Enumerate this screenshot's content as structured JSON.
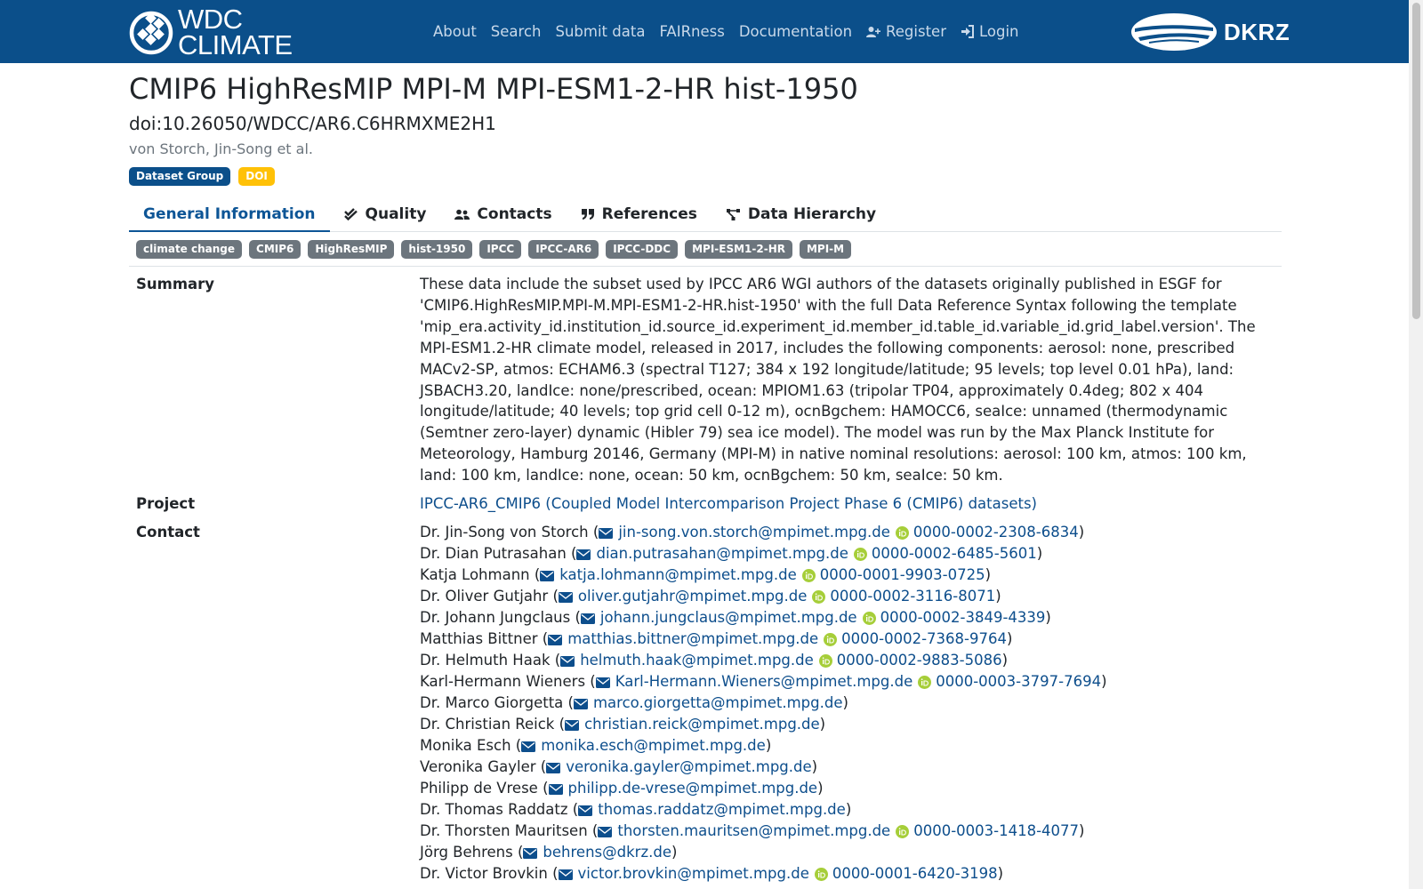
{
  "header": {
    "logo_line1": "WDC",
    "logo_line2": "CLIMATE",
    "nav": [
      {
        "label": "About"
      },
      {
        "label": "Search"
      },
      {
        "label": "Submit data"
      },
      {
        "label": "FAIRness"
      },
      {
        "label": "Documentation"
      },
      {
        "label": "Register",
        "icon": "user-plus-icon"
      },
      {
        "label": "Login",
        "icon": "login-icon"
      }
    ],
    "partner_logo_text": "DKRZ"
  },
  "dataset": {
    "title": "CMIP6 HighResMIP MPI-M MPI-ESM1-2-HR hist-1950",
    "doi": "doi:10.26050/WDCC/AR6.C6HRMXME2H1",
    "authors": "von Storch, Jin-Song et al.",
    "badges": [
      "Dataset Group",
      "DOI"
    ]
  },
  "tabs": [
    {
      "label": "General Information",
      "icon": "info-icon",
      "active": true
    },
    {
      "label": "Quality",
      "icon": "check-double-icon"
    },
    {
      "label": "Contacts",
      "icon": "users-icon"
    },
    {
      "label": "References",
      "icon": "quote-icon"
    },
    {
      "label": "Data Hierarchy",
      "icon": "hierarchy-icon"
    }
  ],
  "tags": [
    "climate change",
    "CMIP6",
    "HighResMIP",
    "hist-1950",
    "IPCC",
    "IPCC-AR6",
    "IPCC-DDC",
    "MPI-ESM1-2-HR",
    "MPI-M"
  ],
  "summary": {
    "label": "Summary",
    "text": "These data include the subset used by IPCC AR6 WGI authors of the datasets originally published in ESGF for 'CMIP6.HighResMIP.MPI-M.MPI-ESM1-2-HR.hist-1950' with the full Data Reference Syntax following the template 'mip_era.activity_id.institution_id.source_id.experiment_id.member_id.table_id.variable_id.grid_label.version'. The MPI-ESM1.2-HR climate model, released in 2017, includes the following components: aerosol: none, prescribed MACv2-SP, atmos: ECHAM6.3 (spectral T127; 384 x 192 longitude/latitude; 95 levels; top level 0.01 hPa), land: JSBACH3.20, landIce: none/prescribed, ocean: MPIOM1.63 (tripolar TP04, approximately 0.4deg; 802 x 404 longitude/latitude; 40 levels; top grid cell 0-12 m), ocnBgchem: HAMOCC6, seaIce: unnamed (thermodynamic (Semtner zero-layer) dynamic (Hibler 79) sea ice model). The model was run by the Max Planck Institute for Meteorology, Hamburg 20146, Germany (MPI-M) in native nominal resolutions: aerosol: 100 km, atmos: 100 km, land: 100 km, landIce: none, ocean: 50 km, ocnBgchem: 50 km, seaIce: 50 km."
  },
  "project": {
    "label": "Project",
    "link_text": "IPCC-AR6_CMIP6 (Coupled Model Intercomparison Project Phase 6 (CMIP6) datasets)"
  },
  "contact": {
    "label": "Contact",
    "people": [
      {
        "name": "Dr. Jin-Song von Storch",
        "email": "jin-song.von.storch@mpimet.mpg.de",
        "orcid": "0000-0002-2308-6834"
      },
      {
        "name": "Dr. Dian Putrasahan",
        "email": "dian.putrasahan@mpimet.mpg.de",
        "orcid": "0000-0002-6485-5601"
      },
      {
        "name": "Katja Lohmann",
        "email": "katja.lohmann@mpimet.mpg.de",
        "orcid": "0000-0001-9903-0725"
      },
      {
        "name": "Dr. Oliver Gutjahr",
        "email": "oliver.gutjahr@mpimet.mpg.de",
        "orcid": "0000-0002-3116-8071"
      },
      {
        "name": "Dr. Johann Jungclaus",
        "email": "johann.jungclaus@mpimet.mpg.de",
        "orcid": "0000-0002-3849-4339"
      },
      {
        "name": "Matthias Bittner",
        "email": "matthias.bittner@mpimet.mpg.de",
        "orcid": "0000-0002-7368-9764"
      },
      {
        "name": "Dr. Helmuth Haak",
        "email": "helmuth.haak@mpimet.mpg.de",
        "orcid": "0000-0002-9883-5086"
      },
      {
        "name": "Karl-Hermann Wieners",
        "email": "Karl-Hermann.Wieners@mpimet.mpg.de",
        "orcid": "0000-0003-3797-7694"
      },
      {
        "name": "Dr. Marco Giorgetta",
        "email": "marco.giorgetta@mpimet.mpg.de",
        "orcid": ""
      },
      {
        "name": "Dr. Christian Reick",
        "email": "christian.reick@mpimet.mpg.de",
        "orcid": ""
      },
      {
        "name": "Monika Esch",
        "email": "monika.esch@mpimet.mpg.de",
        "orcid": ""
      },
      {
        "name": "Veronika Gayler",
        "email": "veronika.gayler@mpimet.mpg.de",
        "orcid": ""
      },
      {
        "name": "Philipp de Vrese",
        "email": "philipp.de-vrese@mpimet.mpg.de",
        "orcid": ""
      },
      {
        "name": "Dr. Thomas Raddatz",
        "email": "thomas.raddatz@mpimet.mpg.de",
        "orcid": ""
      },
      {
        "name": "Dr. Thorsten Mauritsen",
        "email": "thorsten.mauritsen@mpimet.mpg.de",
        "orcid": "0000-0003-1418-4077"
      },
      {
        "name": "Jörg Behrens",
        "email": "behrens@dkrz.de",
        "orcid": ""
      },
      {
        "name": "Dr. Victor Brovkin",
        "email": "victor.brovkin@mpimet.mpg.de",
        "orcid": "0000-0001-6420-3198"
      }
    ]
  },
  "colors": {
    "header_bg": "#0b4f8a",
    "link": "#0d4e8c",
    "tag_bg": "#6c757d",
    "doi_badge": "#ffc107",
    "orcid": "#a6ce39"
  }
}
